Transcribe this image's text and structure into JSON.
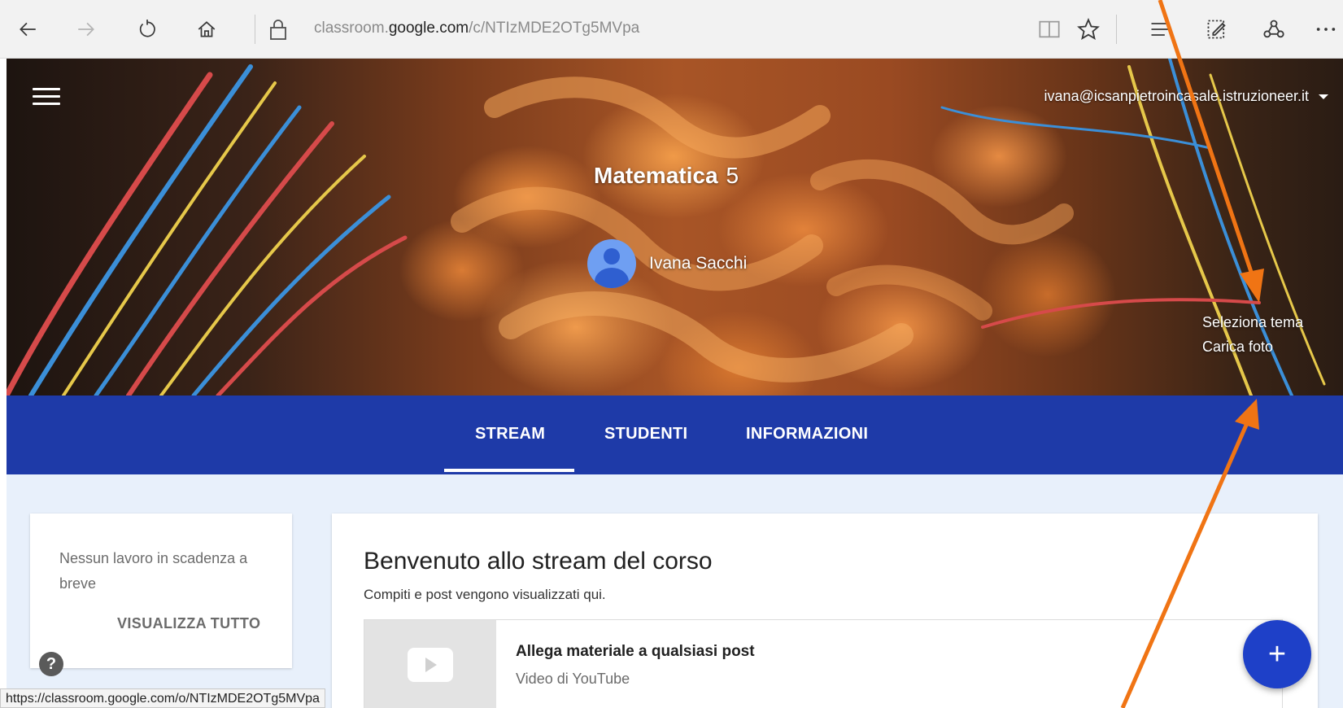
{
  "browser": {
    "url_prefix": "classroom.",
    "url_domain": "google.com",
    "url_path": "/c/NTIzMDE2OTg5MVpa",
    "icons": [
      "back-icon",
      "forward-icon",
      "refresh-icon",
      "home-icon",
      "lock-icon",
      "reading-view-icon",
      "favorite-star-icon",
      "hub-icon",
      "web-note-icon",
      "share-icon",
      "more-icon"
    ]
  },
  "header": {
    "account_email": "ivana@icsanpietroincasale.istruzioneer.it",
    "course_name": "Matematica",
    "course_section": "5",
    "teacher_name": "Ivana Sacchi",
    "select_theme": "Seleziona tema",
    "upload_photo": "Carica foto"
  },
  "tabs": [
    {
      "label": "STREAM",
      "active": true
    },
    {
      "label": "STUDENTI",
      "active": false
    },
    {
      "label": "INFORMAZIONI",
      "active": false
    }
  ],
  "upcoming": {
    "text": "Nessun lavoro in scadenza a breve",
    "view_all": "VISUALIZZA TUTTO"
  },
  "stream": {
    "title": "Benvenuto allo stream del corso",
    "subtitle": "Compiti e post vengono visualizzati qui.",
    "attach_title": "Allega materiale a qualsiasi post",
    "attach_sub": "Video di YouTube"
  },
  "help_label": "?",
  "fab_label": "+",
  "status_url": "https://classroom.google.com/o/NTIzMDE2OTg5MVpa",
  "colors": {
    "tab_bar": "#1e3aa8",
    "fab": "#1e40c8",
    "arrow": "#f07414",
    "content_bg": "#e8f0fb"
  }
}
